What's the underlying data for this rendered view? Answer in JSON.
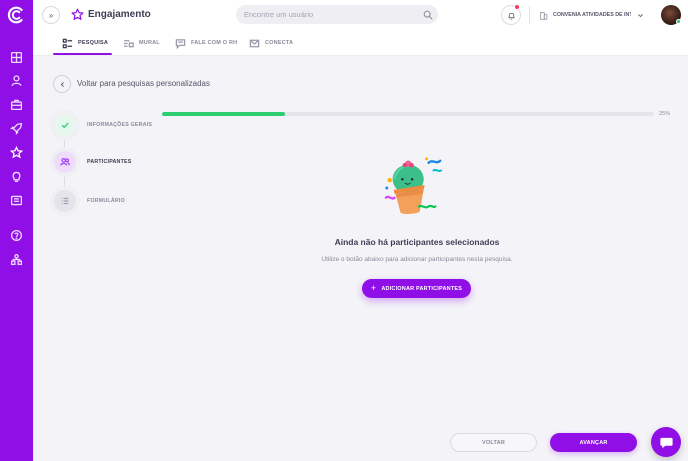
{
  "header": {
    "module_title": "Engajamento",
    "search_placeholder": "Encontre um usuário",
    "company_name": "CONVENIA ATIVIDADES DE INTERNET LTDA"
  },
  "tabs": [
    {
      "label": "PESQUISA",
      "icon": "survey-icon",
      "active": true
    },
    {
      "label": "MURAL",
      "icon": "mural-icon",
      "active": false
    },
    {
      "label": "FALE COM O RH",
      "icon": "chat-rh-icon",
      "active": false
    },
    {
      "label": "CONECTA",
      "icon": "mail-icon",
      "active": false
    }
  ],
  "back": {
    "label": "Voltar para pesquisas personalizadas"
  },
  "steps": [
    {
      "label": "INFORMAÇÕES GERAIS",
      "status": "done"
    },
    {
      "label": "PARTICIPANTES",
      "status": "current"
    },
    {
      "label": "FORMULÁRIO",
      "status": "pending"
    }
  ],
  "progress": {
    "value": 25,
    "label": "25%"
  },
  "empty_state": {
    "title": "Ainda não há participantes selecionados",
    "description": "Utilize o botão abaixo para adicionar participantes nesta pesquisa.",
    "button_label": "ADICIONAR PARTICIPANTES"
  },
  "footer": {
    "back_label": "VOLTAR",
    "next_label": "AVANÇAR"
  },
  "colors": {
    "primary": "#8f0fe6",
    "success": "#2ecc71",
    "notification": "#ff3b5c"
  }
}
